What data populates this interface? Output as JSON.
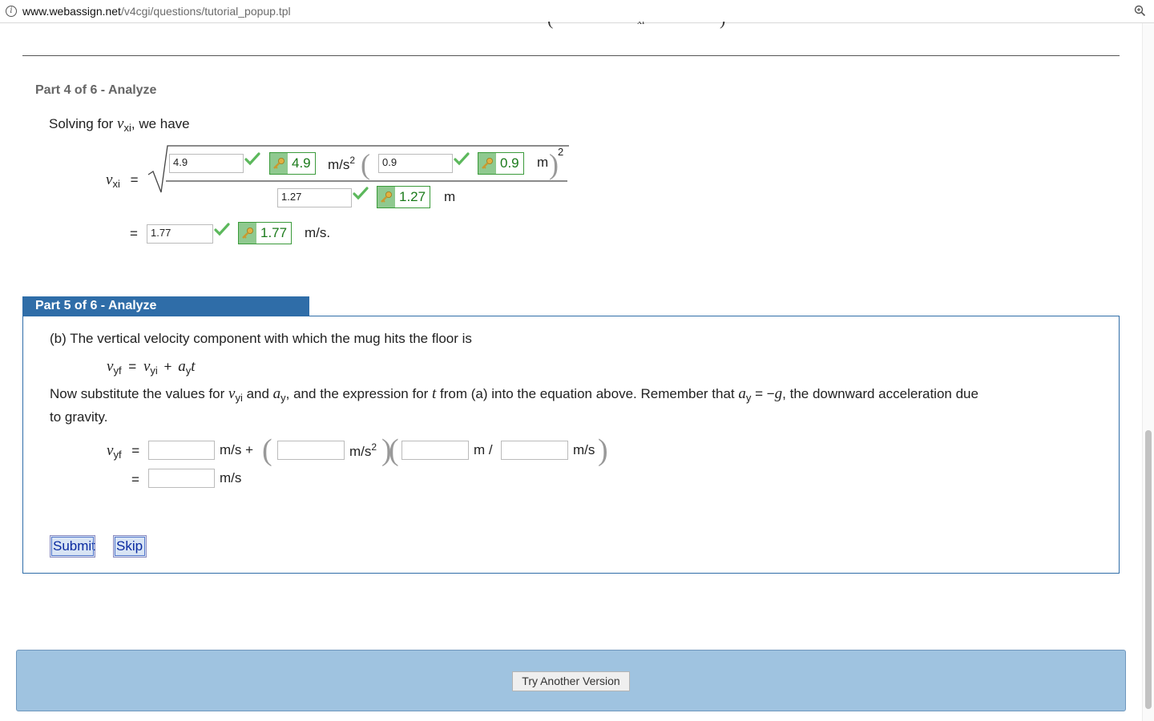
{
  "browser": {
    "url_domain": "www.webassign.net",
    "url_path": "/v4cgi/questions/tutorial_popup.tpl"
  },
  "part4": {
    "title": "Part 4 of 6 - Analyze",
    "intro_text": "Solving for ",
    "intro_var": "v",
    "intro_sub": "xi",
    "intro_after": ", we have",
    "lhs_var": "v",
    "lhs_sub": "xi",
    "eq": "=",
    "num1_input": "4.9",
    "num1_key": "4.9",
    "num1_unit": "m/s",
    "num1_unit_sup": "2",
    "num2_input": "0.9",
    "num2_key": "0.9",
    "num2_unit": "m",
    "outer_sup": "2",
    "den_input": "1.27",
    "den_key": "1.27",
    "den_unit": "m",
    "result_input": "1.77",
    "result_key": "1.77",
    "result_unit": "m/s."
  },
  "part5": {
    "title": "Part 5 of 6 - Analyze",
    "question": "(b) The vertical velocity component with which the mug hits the floor is",
    "eq_lhs_var": "v",
    "eq_lhs_sub": "yf",
    "eq_eq": "=",
    "eq_t1_var": "v",
    "eq_t1_sub": "yi",
    "eq_plus": "+",
    "eq_t2_var": "a",
    "eq_t2_sub": "y",
    "eq_t2_t": "t",
    "instruction_a": "Now substitute the values for ",
    "instr_v": "v",
    "instr_v_sub": "yi",
    "instr_and": " and ",
    "instr_a": "a",
    "instr_a_sub": "y",
    "instr_b": ", and the expression for ",
    "instr_t": "t",
    "instr_c": " from (a) into the equation above. Remember that ",
    "instr_a2": "a",
    "instr_a2_sub": "y",
    "instr_d": " = −",
    "instr_g": "g",
    "instr_e": ", the downward acceleration due",
    "instruction_line2": "to gravity.",
    "row1_lhs_var": "v",
    "row1_lhs_sub": "yf",
    "row1_eq": "=",
    "row1_unit1": "m/s +",
    "row1_unit2": "m/s",
    "row1_unit2_sup": "2",
    "row1_unit3": "m /",
    "row1_unit4": "m/s",
    "row2_eq": "=",
    "row2_unit": "m/s",
    "inputs": [
      "",
      "",
      "",
      "",
      ""
    ],
    "submit_label": "Submit",
    "skip_label": "Skip"
  },
  "footer": {
    "try_label": "Try Another Version"
  },
  "colors": {
    "tab_blue": "#2f6da8",
    "key_green": "#1a7a1a",
    "panel_blue": "#9fc3e0"
  },
  "icons": {
    "check": "check-icon",
    "key": "key-icon",
    "info": "info-icon",
    "zoom": "zoom-icon"
  }
}
